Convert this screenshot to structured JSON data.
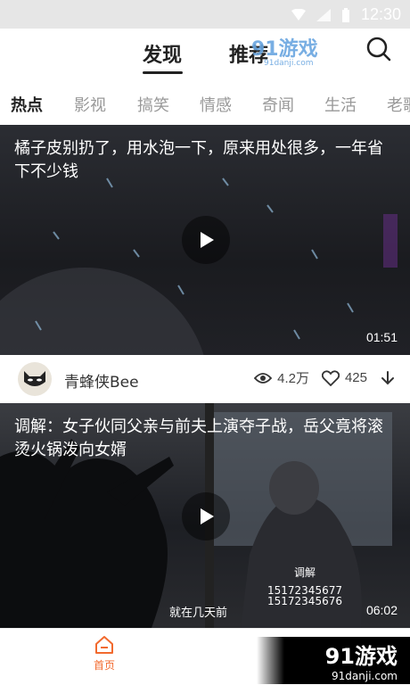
{
  "status_bar": {
    "time": "12:30"
  },
  "header": {
    "tabs": [
      {
        "label": "发现",
        "active": true
      },
      {
        "label": "推荐",
        "active": false
      }
    ],
    "watermark": {
      "text": "91游戏",
      "url": "91danji.com"
    }
  },
  "categories": [
    {
      "label": "热点",
      "active": true
    },
    {
      "label": "影视",
      "active": false
    },
    {
      "label": "搞笑",
      "active": false
    },
    {
      "label": "情感",
      "active": false
    },
    {
      "label": "奇闻",
      "active": false
    },
    {
      "label": "生活",
      "active": false
    },
    {
      "label": "老歌",
      "active": false
    }
  ],
  "feed": [
    {
      "title": "橘子皮别扔了，用水泡一下，原来用处很多，一年省下不少钱",
      "duration": "01:51",
      "author": "青蜂侠Bee",
      "views": "4.2万",
      "likes": "425"
    },
    {
      "title": "调解：女子伙同父亲与前夫上演夺子战，岳父竟将滚烫火锅泼向女婿",
      "duration": "06:02",
      "subtitle": "就在几天前",
      "phone_lines": [
        "15172345677",
        "15172345676"
      ],
      "channel_text": "调解"
    }
  ],
  "bottom_nav": {
    "home_label": "首页"
  },
  "bottom_watermark": {
    "name": "91游戏",
    "url": "91danji.com"
  },
  "colors": {
    "accent": "#f26a2e",
    "text": "#222222",
    "muted": "#999999"
  }
}
